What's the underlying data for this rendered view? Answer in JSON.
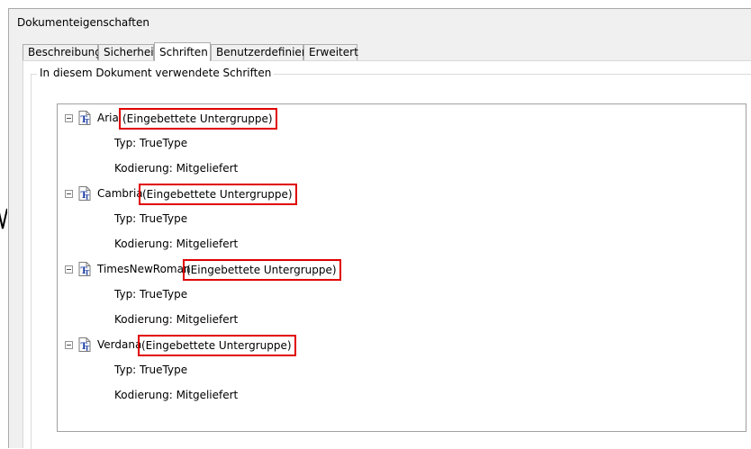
{
  "dialog": {
    "title": "Dokumenteigenschaften",
    "tabs": [
      {
        "label": "Beschreibung",
        "active": false
      },
      {
        "label": "Sicherheit",
        "active": false
      },
      {
        "label": "Schriften",
        "active": true
      },
      {
        "label": "Benutzerdefiniert",
        "active": false
      },
      {
        "label": "Erweitert",
        "active": false
      }
    ],
    "group_label": "In diesem Dokument verwendete Schriften"
  },
  "fonts": [
    {
      "name": "Arial",
      "subset": "(Eingebettete Untergruppe)",
      "type": "Typ: TrueType",
      "encoding": "Kodierung: Mitgeliefert"
    },
    {
      "name": "Cambria",
      "subset": "(Eingebettete Untergruppe)",
      "type": "Typ: TrueType",
      "encoding": "Kodierung: Mitgeliefert"
    },
    {
      "name": "TimesNewRoman",
      "subset": "(Eingebettete Untergruppe)",
      "type": "Typ: TrueType",
      "encoding": "Kodierung: Mitgeliefert"
    },
    {
      "name": "Verdana",
      "subset": "(Eingebettete Untergruppe)",
      "type": "Typ: TrueType",
      "encoding": "Kodierung: Mitgeliefert"
    }
  ],
  "colors": {
    "highlight": "#e00000",
    "icon_blue": "#1f3fa6"
  }
}
